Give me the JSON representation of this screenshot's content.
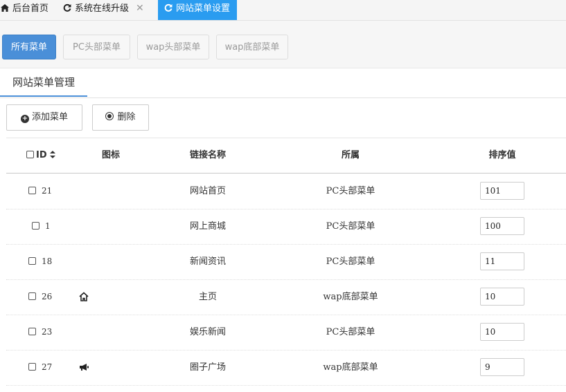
{
  "tabs": [
    {
      "label": "后台首页",
      "icon": "home-icon",
      "active": false,
      "closable": false
    },
    {
      "label": "系统在线升级",
      "icon": "refresh-icon",
      "active": false,
      "closable": true
    },
    {
      "label": "网站菜单设置",
      "icon": "refresh-icon",
      "active": true,
      "closable": false
    }
  ],
  "filters": [
    "所有菜单",
    "PC头部菜单",
    "wap头部菜单",
    "wap底部菜单"
  ],
  "panel_title": "网站菜单管理",
  "actions": {
    "add": "添加菜单",
    "delete": "删除"
  },
  "table": {
    "headers": {
      "id": "ID",
      "icon": "图标",
      "name": "链接名称",
      "group": "所属",
      "sort": "排序值"
    },
    "rows": [
      {
        "id": "21",
        "icon": "",
        "name": "网站首页",
        "group": "PC头部菜单",
        "sort": "101"
      },
      {
        "id": "1",
        "icon": "",
        "name": "网上商城",
        "group": "PC头部菜单",
        "sort": "100"
      },
      {
        "id": "18",
        "icon": "",
        "name": "新闻资讯",
        "group": "PC头部菜单",
        "sort": "11"
      },
      {
        "id": "26",
        "icon": "home-outline-icon",
        "name": "主页",
        "group": "wap底部菜单",
        "sort": "10"
      },
      {
        "id": "23",
        "icon": "",
        "name": "娱乐新闻",
        "group": "PC头部菜单",
        "sort": "10"
      },
      {
        "id": "27",
        "icon": "megaphone-icon",
        "name": "圈子广场",
        "group": "wap底部菜单",
        "sort": "9"
      }
    ]
  },
  "colors": {
    "active_tab": "#2a9cf0",
    "active_filter": "#4a8fd8"
  }
}
